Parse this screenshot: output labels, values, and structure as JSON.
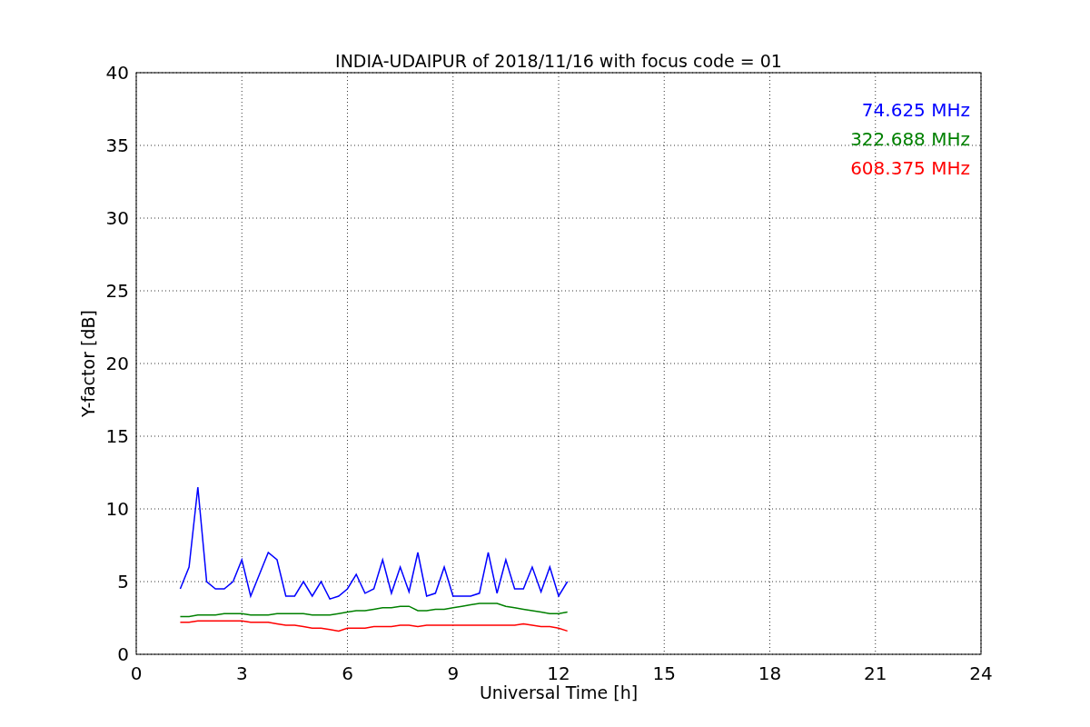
{
  "chart_data": {
    "type": "line",
    "title": "INDIA-UDAIPUR of 2018/11/16 with focus code = 01",
    "xlabel": "Universal Time [h]",
    "ylabel": "Y-factor [dB]",
    "x": [
      1.25,
      1.5,
      1.75,
      2,
      2.25,
      2.5,
      2.75,
      3,
      3.25,
      3.5,
      3.75,
      4,
      4.25,
      4.5,
      4.75,
      5,
      5.25,
      5.5,
      5.75,
      6,
      6.25,
      6.5,
      6.75,
      7,
      7.25,
      7.5,
      7.75,
      8,
      8.25,
      8.5,
      8.75,
      9,
      9.25,
      9.5,
      9.75,
      10,
      10.25,
      10.5,
      10.75,
      11,
      11.25,
      11.5,
      11.75,
      12,
      12.25
    ],
    "series": [
      {
        "name": "74.625 MHz",
        "color": "#0000ff",
        "values": [
          4.5,
          6,
          11.5,
          5,
          4.5,
          4.5,
          5,
          6.5,
          4,
          5.5,
          7,
          6.5,
          4,
          4,
          5,
          4,
          5,
          3.8,
          4,
          4.5,
          5.5,
          4.2,
          4.5,
          6.5,
          4.2,
          6,
          4.3,
          7,
          4,
          4.2,
          6,
          4,
          4,
          4,
          4.2,
          7,
          4.2,
          6.5,
          4.5,
          4.5,
          6,
          4.3,
          6,
          4,
          5
        ]
      },
      {
        "name": "322.688 MHz",
        "color": "#008000",
        "values": [
          2.6,
          2.6,
          2.7,
          2.7,
          2.7,
          2.8,
          2.8,
          2.8,
          2.7,
          2.7,
          2.7,
          2.8,
          2.8,
          2.8,
          2.8,
          2.7,
          2.7,
          2.7,
          2.8,
          2.9,
          3,
          3,
          3.1,
          3.2,
          3.2,
          3.3,
          3.3,
          3,
          3,
          3.1,
          3.1,
          3.2,
          3.3,
          3.4,
          3.5,
          3.5,
          3.5,
          3.3,
          3.2,
          3.1,
          3,
          2.9,
          2.8,
          2.8,
          2.9
        ]
      },
      {
        "name": "608.375 MHz",
        "color": "#ff0000",
        "values": [
          2.2,
          2.2,
          2.3,
          2.3,
          2.3,
          2.3,
          2.3,
          2.3,
          2.2,
          2.2,
          2.2,
          2.1,
          2,
          2,
          1.9,
          1.8,
          1.8,
          1.7,
          1.6,
          1.8,
          1.8,
          1.8,
          1.9,
          1.9,
          1.9,
          2,
          2,
          1.9,
          2,
          2,
          2,
          2,
          2,
          2,
          2,
          2,
          2,
          2,
          2,
          2.1,
          2,
          1.9,
          1.9,
          1.8,
          1.6
        ]
      }
    ],
    "grid": true,
    "xlim": [
      0,
      24
    ],
    "ylim": [
      0,
      40
    ],
    "xticks": [
      0,
      3,
      6,
      9,
      12,
      15,
      18,
      21,
      24
    ],
    "yticks": [
      0,
      5,
      10,
      15,
      20,
      25,
      30,
      35,
      40
    ]
  }
}
